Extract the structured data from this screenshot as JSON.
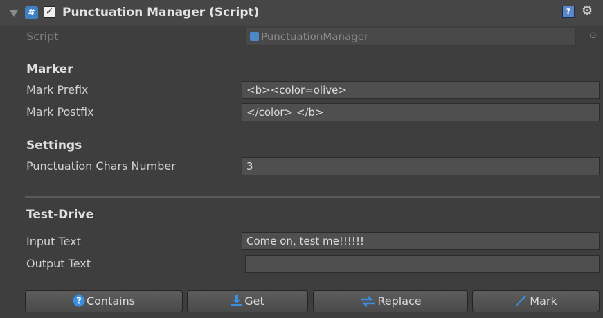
{
  "header": {
    "title": "Punctuation Manager (Script)",
    "cs_icon": "#",
    "checkbox": "✓",
    "help_icon": "?",
    "gear_icon": "⚙"
  },
  "script": {
    "label": "Script",
    "value": "PunctuationManager",
    "picker_icon": "⊙"
  },
  "marker": {
    "section": "Marker",
    "mark_prefix_label": "Mark Prefix",
    "mark_prefix_value": " <b><color=olive>",
    "mark_postfix_label": "Mark Postfix",
    "mark_postfix_value": "</color> </b>"
  },
  "settings": {
    "section": "Settings",
    "punct_label": "Punctuation Chars Number",
    "punct_value": "3"
  },
  "test_drive": {
    "section": "Test-Drive",
    "input_label": "Input Text",
    "input_value": "Come on, test me!!!!!!",
    "output_label": "Output Text",
    "output_value": ""
  },
  "buttons": {
    "contains": "Contains",
    "get": "Get",
    "replace": "Replace",
    "mark": "Mark"
  },
  "colors": {
    "background": "#3e3e3e",
    "field": "#4f4f4f",
    "accent": "#3f7fc4"
  }
}
